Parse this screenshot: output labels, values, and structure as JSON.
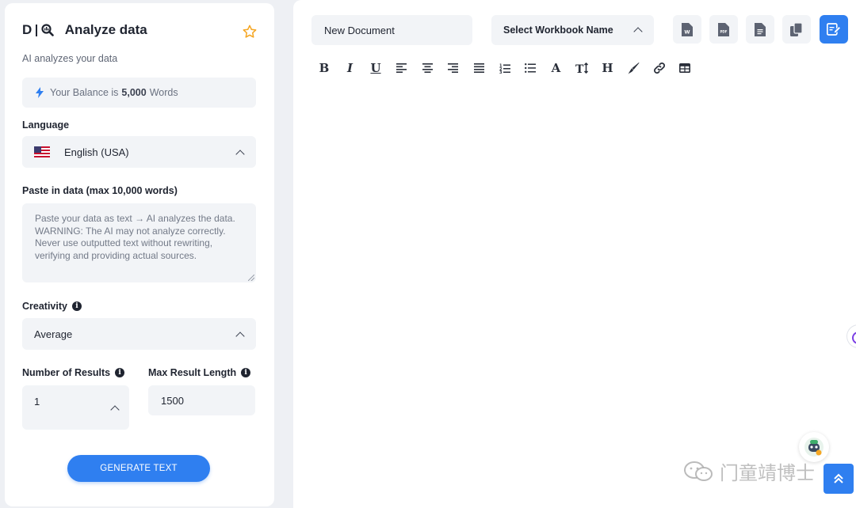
{
  "sidebar": {
    "logo_text": "D",
    "title": "Analyze data",
    "subtitle": "AI analyzes your data",
    "balance": {
      "prefix": "Your Balance is",
      "amount": "5,000",
      "unit": "Words"
    },
    "language": {
      "label": "Language",
      "value": "English (USA)"
    },
    "paste": {
      "label": "Paste in data (max 10,000 words)",
      "placeholder": "Paste your data as text → AI analyzes the data. WARNING: The AI may not analyze correctly. Never use outputted text without rewriting, verifying and providing actual sources."
    },
    "creativity": {
      "label": "Creativity",
      "value": "Average"
    },
    "results": {
      "label": "Number of Results",
      "value": "1"
    },
    "max_length": {
      "label": "Max Result Length",
      "value": "1500"
    },
    "generate_label": "GENERATE TEXT"
  },
  "editor": {
    "document_name": "New Document",
    "workbook_select": "Select Workbook Name",
    "toolbar_buttons": [
      "word-export",
      "pdf-export",
      "txt-export",
      "copy",
      "save-edit"
    ],
    "format_tools": [
      "bold",
      "italic",
      "underline",
      "align-left",
      "align-center",
      "align-right",
      "justify",
      "ordered-list",
      "unordered-list",
      "font-color",
      "font-size",
      "heading",
      "highlighter",
      "link",
      "table"
    ]
  },
  "watermark": "门童靖博士",
  "colors": {
    "accent": "#2f7ff0",
    "star": "#f5a623",
    "panel_bg": "#ffffff",
    "field_bg": "#f2f4f7"
  }
}
